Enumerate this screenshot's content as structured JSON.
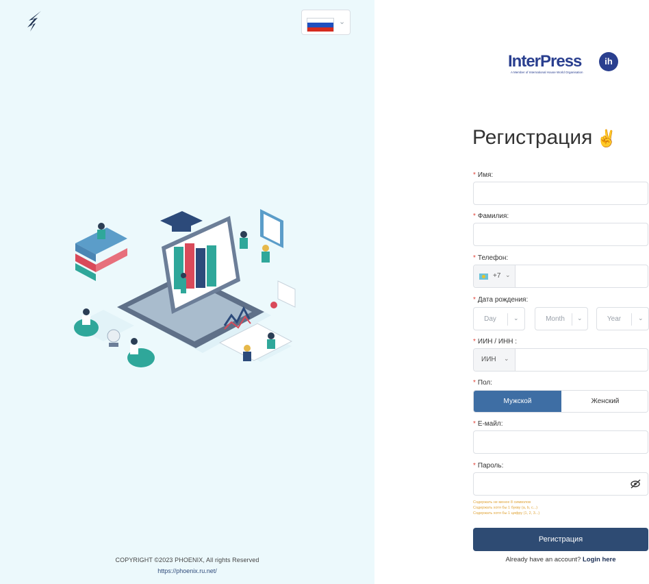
{
  "left": {
    "copyright": "COPYRIGHT ©2023 PHOENIX, All rights Reserved",
    "site_url": "https://phoenix.ru.net/"
  },
  "brand": {
    "name": "InterPress",
    "badge": "ih",
    "tagline": "A Member of International House World Organisation"
  },
  "form": {
    "title": "Регистрация",
    "title_emoji": "✌️",
    "required_mark": "*",
    "first_name": {
      "label": "Имя:",
      "value": ""
    },
    "last_name": {
      "label": "Фамилия:",
      "value": ""
    },
    "phone": {
      "label": "Телефон:",
      "code": "+7",
      "value": ""
    },
    "birth_date": {
      "label": "Дата рождения:",
      "day": "Day",
      "month": "Month",
      "year": "Year"
    },
    "inn": {
      "label": "ИИН / ИНН :",
      "type": "ИИН",
      "value": ""
    },
    "gender": {
      "label": "Пол:",
      "male": "Мужской",
      "female": "Женский",
      "selected": "male"
    },
    "email": {
      "label": "Е-майл:",
      "value": ""
    },
    "password": {
      "label": "Пароль:",
      "value": "",
      "hints": [
        "Содержать не менее 8 символов",
        "Содержать хотя бы 1 букву (a, b, c...)",
        "Содержать хотя бы 1 цифру (1, 2, 3...)"
      ]
    },
    "submit_label": "Регистрация",
    "login_prompt": "Already have an account?",
    "login_link": "Login here"
  },
  "colors": {
    "left_bg": "#ecf9fc",
    "accent": "#3e6ea4",
    "submit_bg": "#2e4b73",
    "hint": "#e0a53a",
    "required": "#e0453a"
  }
}
